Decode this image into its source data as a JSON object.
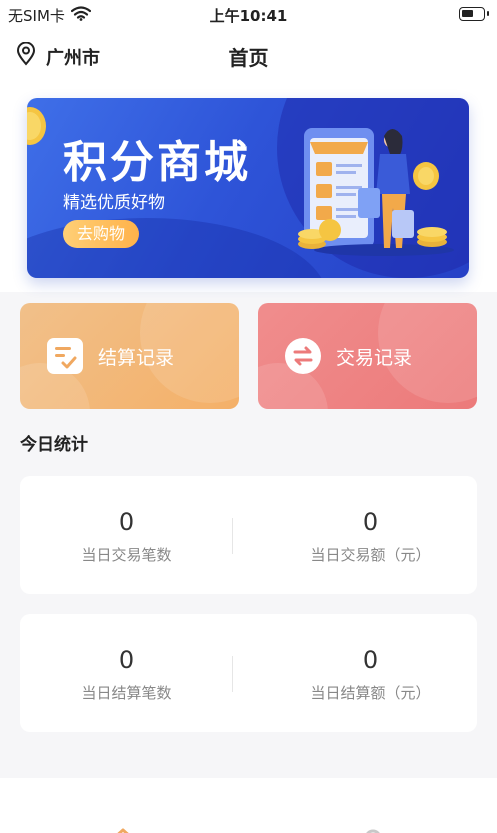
{
  "status_bar": {
    "carrier": "无SIM卡",
    "time": "上午10:41",
    "battery_level": 0.6
  },
  "nav": {
    "city": "广州市",
    "title": "首页"
  },
  "banner": {
    "title": "积分商城",
    "subtitle": "精选优质好物",
    "button_label": "去购物"
  },
  "actions": {
    "settle_label": "结算记录",
    "trade_label": "交易记录"
  },
  "today": {
    "section_title": "今日统计",
    "trade_count_value": "0",
    "trade_count_label": "当日交易笔数",
    "trade_amount_value": "0",
    "trade_amount_label": "当日交易额（元）",
    "settle_count_value": "0",
    "settle_count_label": "当日结算笔数",
    "settle_amount_value": "0",
    "settle_amount_label": "当日结算额（元）"
  },
  "colors": {
    "banner_blue": "#2e54d8",
    "settle_orange": "#f4b068",
    "trade_red": "#ec7a7a",
    "tab_active": "#f0a860"
  }
}
